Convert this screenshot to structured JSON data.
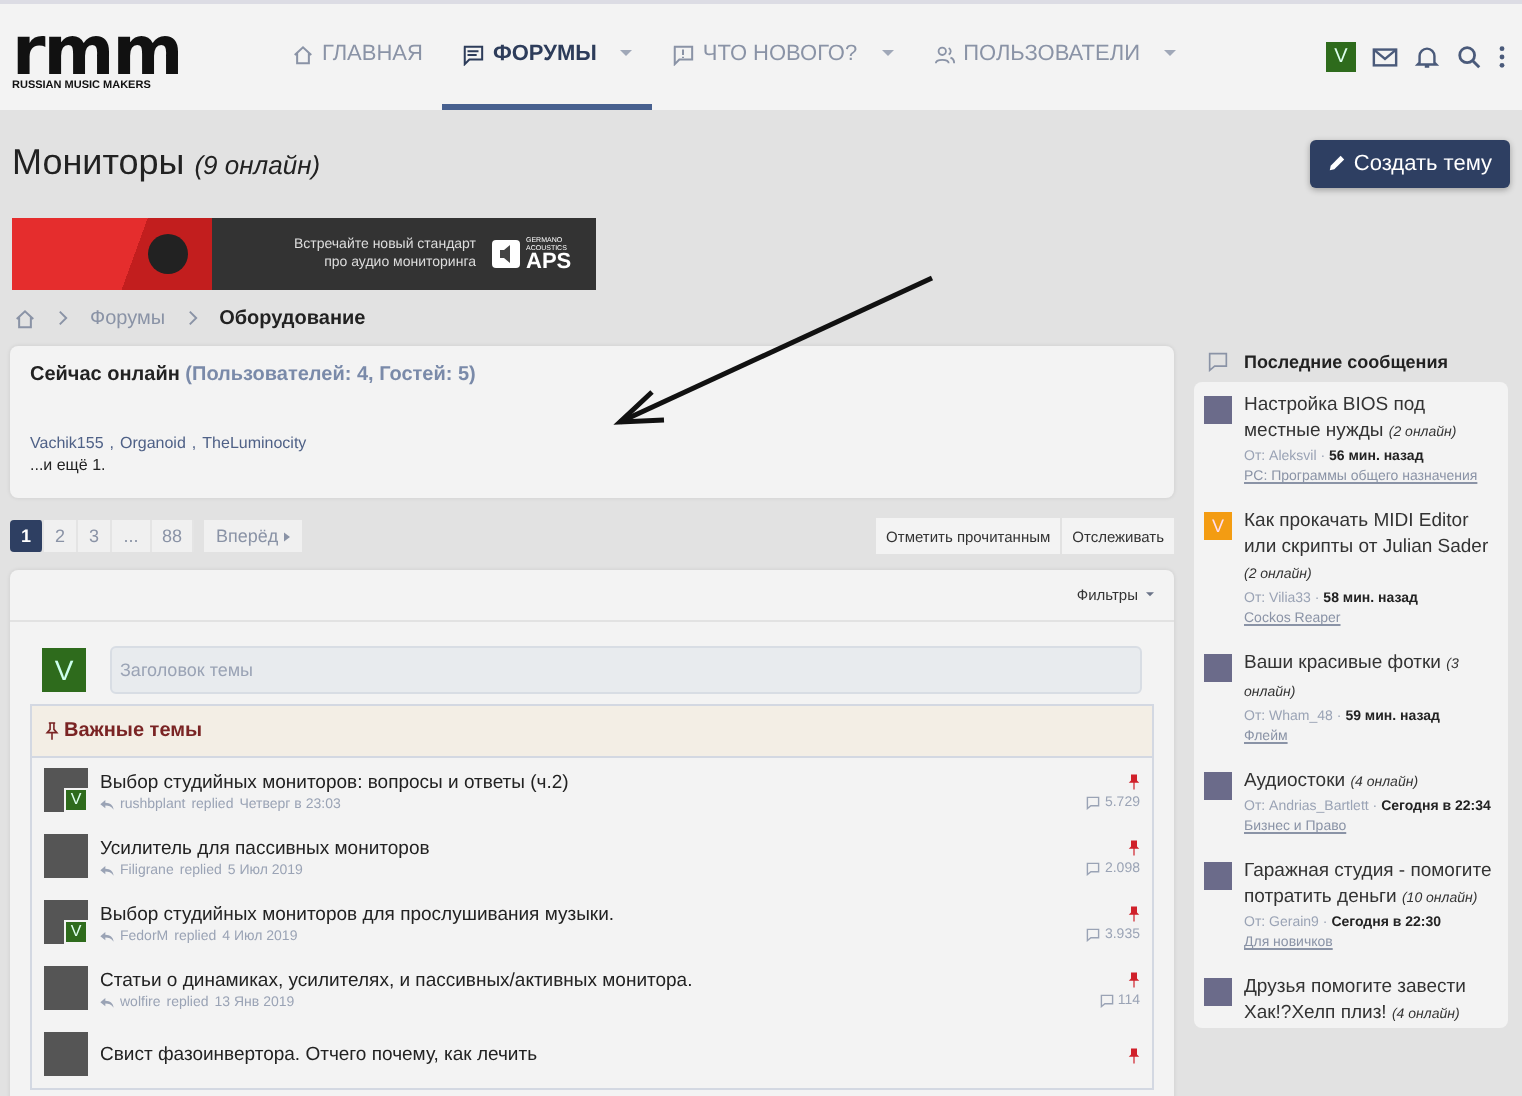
{
  "header": {
    "logo": "rmm",
    "logo_tagline": "RUSSIAN MUSIC MAKERS",
    "user_initial": "V",
    "nav": [
      {
        "label": "ГЛАВНАЯ",
        "kind": "home",
        "selected": false,
        "has_menu": false
      },
      {
        "label": "ФОРУМЫ",
        "kind": "forum",
        "selected": true,
        "has_menu": true
      },
      {
        "label": "ЧТО НОВОГО?",
        "kind": "news",
        "selected": false,
        "has_menu": true
      },
      {
        "label": "ПОЛЬЗОВАТЕЛИ",
        "kind": "users",
        "selected": false,
        "has_menu": true
      }
    ]
  },
  "page": {
    "title": "Мониторы",
    "subtitle": "(9 онлайн)",
    "create_button": "Создать тему"
  },
  "banner": {
    "line_1": "Встречайте новый стандарт",
    "line_2": "про аудио мониторинга",
    "brand_small": "GERMANO ACOUSTICS",
    "brand": "APS"
  },
  "breadcrumbs": [
    {
      "label": "Форумы",
      "current": false
    },
    {
      "label": "Оборудование",
      "current": true
    }
  ],
  "online": {
    "title": "Сейчас онлайн",
    "counts": "(Пользователей: 4, Гостей: 5)",
    "users": [
      {
        "name": "Vachik155",
        "separator": ","
      },
      {
        "name": "Organoid",
        "separator": ","
      },
      {
        "name": "TheLuminocity"
      }
    ],
    "more": "...и ещё 1."
  },
  "pagination": {
    "pages": [
      {
        "label": "1",
        "selected": true
      },
      {
        "label": "2",
        "selected": false
      },
      {
        "label": "3",
        "selected": false
      },
      {
        "label": "...",
        "selected": false
      },
      {
        "label": "88",
        "selected": false
      }
    ],
    "next": "Вперёд"
  },
  "actions": [
    "Отметить прочитанным",
    "Отслеживать"
  ],
  "filters": "Фильтры",
  "new_thread": {
    "avatar": "V",
    "placeholder": "Заголовок темы"
  },
  "sticky": {
    "title": "Важные темы",
    "threads": [
      {
        "title": "Выбор студийных мониторов: вопросы и ответы (ч.2)",
        "user": "rushbplant",
        "action": "replied",
        "date": "Четверг в 23:03",
        "replies": "5.729",
        "badge": "V"
      },
      {
        "title": "Усилитель для пассивных мониторов",
        "user": "Filigrane",
        "action": "replied",
        "date": "5 Июл 2019",
        "replies": "2.098"
      },
      {
        "title": "Выбор студийных мониторов для прослушивания музыки.",
        "user": "FedorM",
        "action": "replied",
        "date": "4 Июл 2019",
        "replies": "3.935",
        "badge": "V"
      },
      {
        "title": "Статьи о динамиках, усилителях, и пассивных/активных монитора.",
        "user": "wolfire",
        "action": "replied",
        "date": "13 Янв 2019",
        "replies": "114"
      },
      {
        "title": "Свист фазоинвертора. Отчего почему, как лечить"
      }
    ]
  },
  "sidebar": {
    "title": "Последние сообщения",
    "posts": [
      {
        "title": "Настройка BIOS под местные нужды",
        "online": "(2 онлайн)",
        "from": "От: Aleksvil ·",
        "time": "56 мин. назад",
        "forum": "PC: Программы общего назначения"
      },
      {
        "title": "Как прокачать MIDI Editor или скрипты от Julian Sader",
        "online": "(2 онлайн)",
        "from": "От: Vilia33 ·",
        "time": "58 мин. назад",
        "forum": "Cockos Reaper",
        "avatar_letter": "V"
      },
      {
        "title": "Ваши красивые фотки",
        "online": "(3 онлайн)",
        "from": "От: Wham_48 ·",
        "time": "59 мин. назад",
        "forum": "Флейм"
      },
      {
        "title": "Аудиостоки",
        "online": "(4 онлайн)",
        "from": "От: Andrias_Bartlett ·",
        "time": "Сегодня в 22:34",
        "forum": "Бизнес и Право"
      },
      {
        "title": "Гаражная студия - помогите потратить деньги",
        "online": "(10 онлайн)",
        "from": "От: Gerain9 ·",
        "time": "Сегодня в 22:30",
        "forum": "Для новичков"
      },
      {
        "title": "Друзья помогите завести Хак!?Хелп плиз!",
        "online": "(4 онлайн)"
      }
    ]
  }
}
